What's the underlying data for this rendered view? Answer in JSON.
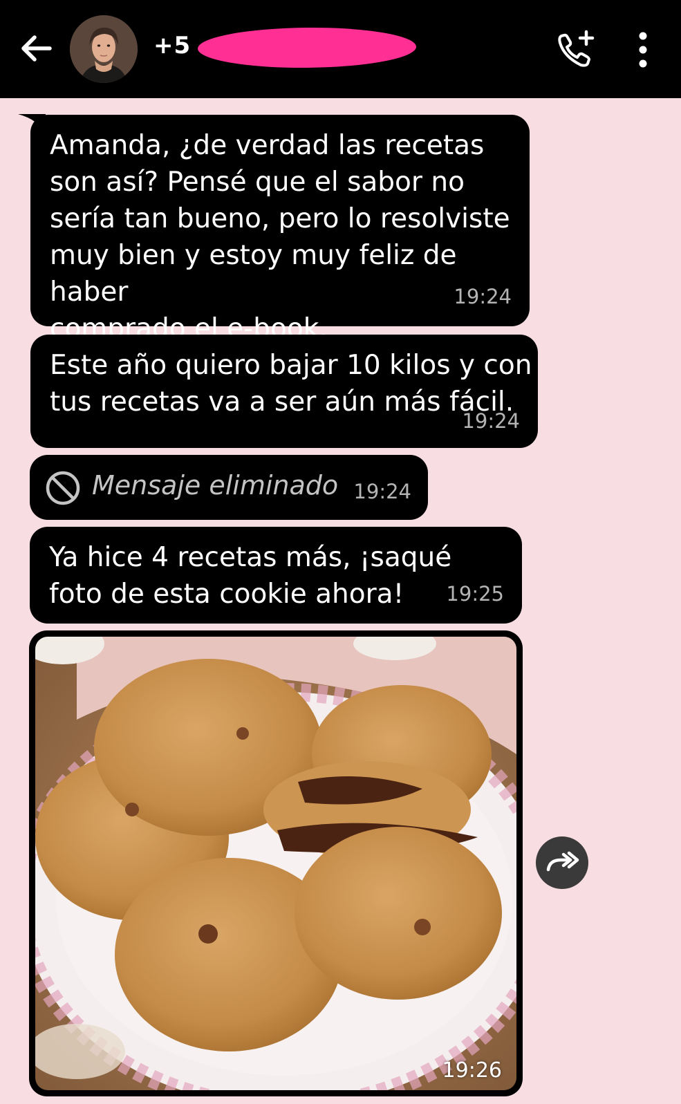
{
  "header": {
    "back_icon": "arrow-left-icon",
    "contact_number": "+5",
    "call_icon": "phone-add-icon",
    "menu_icon": "more-vertical-icon"
  },
  "messages": [
    {
      "lines": [
        "Amanda, ¿de verdad las recetas",
        "son así? Pensé que el sabor no",
        "sería tan bueno, pero lo resolviste",
        "muy bien y estoy muy feliz de haber",
        "comprado el e-book."
      ],
      "time": "19:24"
    },
    {
      "lines": [
        "Este año quiero bajar 10 kilos y con",
        "tus recetas va a ser aún más fácil."
      ],
      "time": "19:24"
    },
    {
      "deleted_text": "Mensaje eliminado",
      "deleted_icon": "prohibited-icon",
      "time": "19:24"
    },
    {
      "lines": [
        "Ya hice 4 recetas más, ¡saqué",
        "foto de esta cookie ahora!"
      ],
      "time": "19:25"
    },
    {
      "image": "cookies-photo",
      "time": "19:26"
    }
  ],
  "forward_icon": "forward-icon",
  "colors": {
    "background": "#f8dde2",
    "bubble": "#000000",
    "redaction": "#ff2f94"
  }
}
